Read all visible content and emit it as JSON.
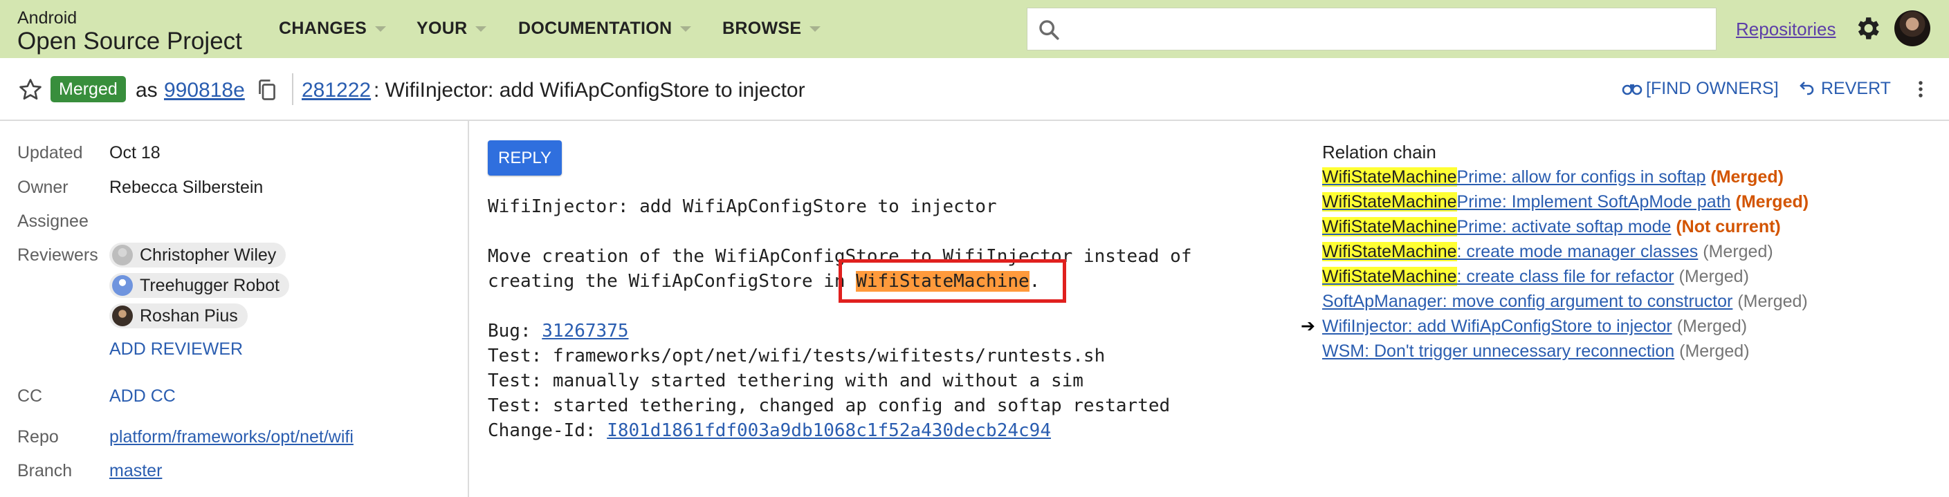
{
  "header": {
    "logo_small": "Android",
    "logo_big": "Open Source Project",
    "nav": [
      "CHANGES",
      "YOUR",
      "DOCUMENTATION",
      "BROWSE"
    ],
    "search_placeholder": "",
    "repositories": "Repositories",
    "icons": {
      "search": "search-icon",
      "settings": "gear-icon",
      "avatar": "user-avatar"
    }
  },
  "change_header": {
    "status": "Merged",
    "as_label": "as",
    "commit": "990818e",
    "number": "281222",
    "title": ": WifiInjector: add WifiApConfigStore to injector",
    "find_owners": "[FIND OWNERS]",
    "revert": "REVERT"
  },
  "metadata": {
    "updated_label": "Updated",
    "updated_value": "Oct 18",
    "owner_label": "Owner",
    "owner_value": "Rebecca Silberstein",
    "assignee_label": "Assignee",
    "reviewers_label": "Reviewers",
    "reviewers": [
      "Christopher Wiley",
      "Treehugger Robot",
      "Roshan Pius"
    ],
    "add_reviewer": "ADD REVIEWER",
    "cc_label": "CC",
    "add_cc": "ADD CC",
    "repo_label": "Repo",
    "repo_value": "platform/frameworks/opt/net/wifi",
    "branch_label": "Branch",
    "branch_value": "master"
  },
  "message": {
    "reply": "REPLY",
    "line1": "WifiInjector: add WifiApConfigStore to injector",
    "line2": "Move creation of the WifiApConfigStore to WifiInjector instead of",
    "line3_pre": "creating the WifiApConfigStore in ",
    "line3_hl": "WifiStateMachine",
    "line3_post": ".",
    "bug_label": "Bug: ",
    "bug_link": "31267375",
    "test1": "Test: frameworks/opt/net/wifi/tests/wifitests/runtests.sh",
    "test2": "Test: manually started tethering with and without a sim",
    "test3": "Test: started tethering, changed ap config and softap restarted",
    "changeid_label": "Change-Id: ",
    "changeid_link": "I801d1861fdf003a9db1068c1f52a430decb24c94"
  },
  "relation_chain": {
    "title": "Relation chain",
    "items": [
      {
        "hl": "WifiStateMachine",
        "rest": "Prime: allow for configs in softap",
        "status": "(Merged)"
      },
      {
        "hl": "WifiStateMachine",
        "rest": "Prime: Implement SoftApMode path",
        "status": "(Merged)"
      },
      {
        "hl": "WifiStateMachine",
        "rest": "Prime: activate softap mode",
        "status": "(Not current)"
      },
      {
        "hl": "WifiStateMachine",
        "rest": ": create mode manager classes",
        "status": "(Merged)"
      },
      {
        "hl": "WifiStateMachine",
        "rest": ": create class file for refactor",
        "status": "(Merged)"
      },
      {
        "hl": "",
        "rest": "SoftApManager: move config argument to constructor",
        "status": "(Merged)"
      },
      {
        "hl": "",
        "rest": "WifiInjector: add WifiApConfigStore to injector",
        "status": "(Merged)",
        "current": true
      },
      {
        "hl": "",
        "rest": "WSM: Don't trigger unnecessary reconnection",
        "status": "(Merged)"
      }
    ],
    "current_marker": "➔"
  }
}
